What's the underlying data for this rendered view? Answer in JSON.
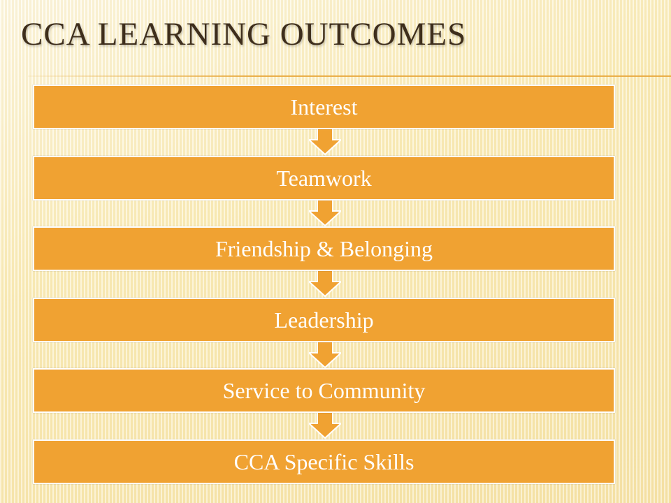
{
  "slide": {
    "title": "CCA Learning Outcomes"
  },
  "diagram": {
    "steps": [
      {
        "label": "Interest"
      },
      {
        "label": "Teamwork"
      },
      {
        "label": "Friendship & Belonging"
      },
      {
        "label": "Leadership"
      },
      {
        "label": "Service to Community"
      },
      {
        "label": "CCA Specific Skills"
      }
    ],
    "colors": {
      "box_fill": "#f0a232",
      "box_border": "#ffffff",
      "arrow_fill": "#f0a232",
      "arrow_stroke": "#ffffff",
      "title_text": "#3e2e1c",
      "label_text": "#ffffff"
    }
  }
}
